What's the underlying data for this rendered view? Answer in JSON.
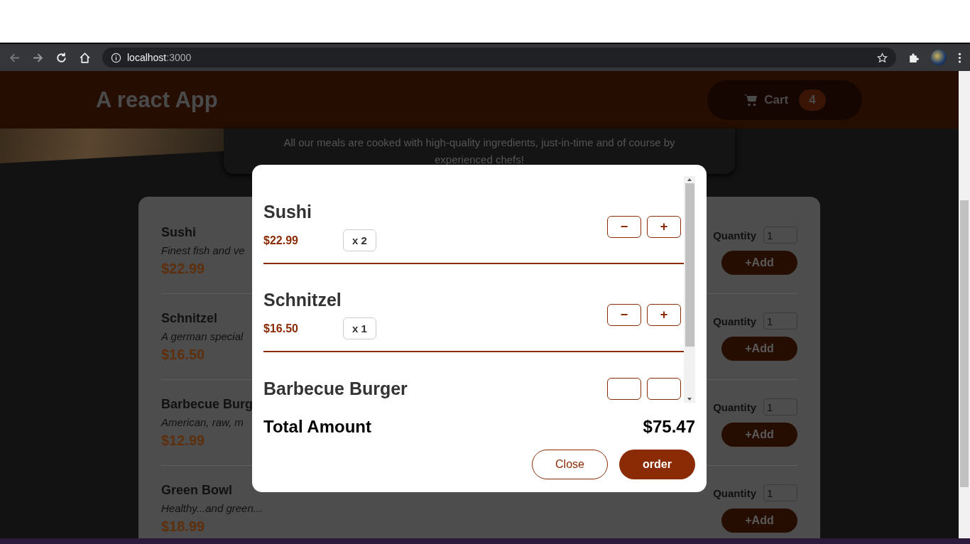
{
  "browser": {
    "url_host": "localhost",
    "url_port": ":3000"
  },
  "header": {
    "title": "A react App",
    "cart_label": "Cart",
    "cart_count": "4"
  },
  "summary": {
    "text": "All our meals are cooked with high-quality ingredients, just-in-time and of course by experienced chefs!"
  },
  "meals": [
    {
      "name": "Sushi",
      "description": "Finest fish and ve",
      "price": "$22.99",
      "quantity_label": "Quantity",
      "quantity": "1",
      "add_label": "+Add"
    },
    {
      "name": "Schnitzel",
      "description": "A german special",
      "price": "$16.50",
      "quantity_label": "Quantity",
      "quantity": "1",
      "add_label": "+Add"
    },
    {
      "name": "Barbecue Burg",
      "description": "American, raw, m",
      "price": "$12.99",
      "quantity_label": "Quantity",
      "quantity": "1",
      "add_label": "+Add"
    },
    {
      "name": "Green Bowl",
      "description": "Healthy...and green...",
      "price": "$18.99",
      "quantity_label": "Quantity",
      "quantity": "1",
      "add_label": "+Add"
    }
  ],
  "cart_modal": {
    "items": [
      {
        "name": "Sushi",
        "price": "$22.99",
        "amount": "x 2",
        "decrease": "−",
        "increase": "+"
      },
      {
        "name": "Schnitzel",
        "price": "$16.50",
        "amount": "x 1",
        "decrease": "−",
        "increase": "+"
      },
      {
        "name": "Barbecue Burger"
      }
    ],
    "total_label": "Total Amount",
    "total": "$75.47",
    "close_label": "Close",
    "order_label": "order"
  }
}
